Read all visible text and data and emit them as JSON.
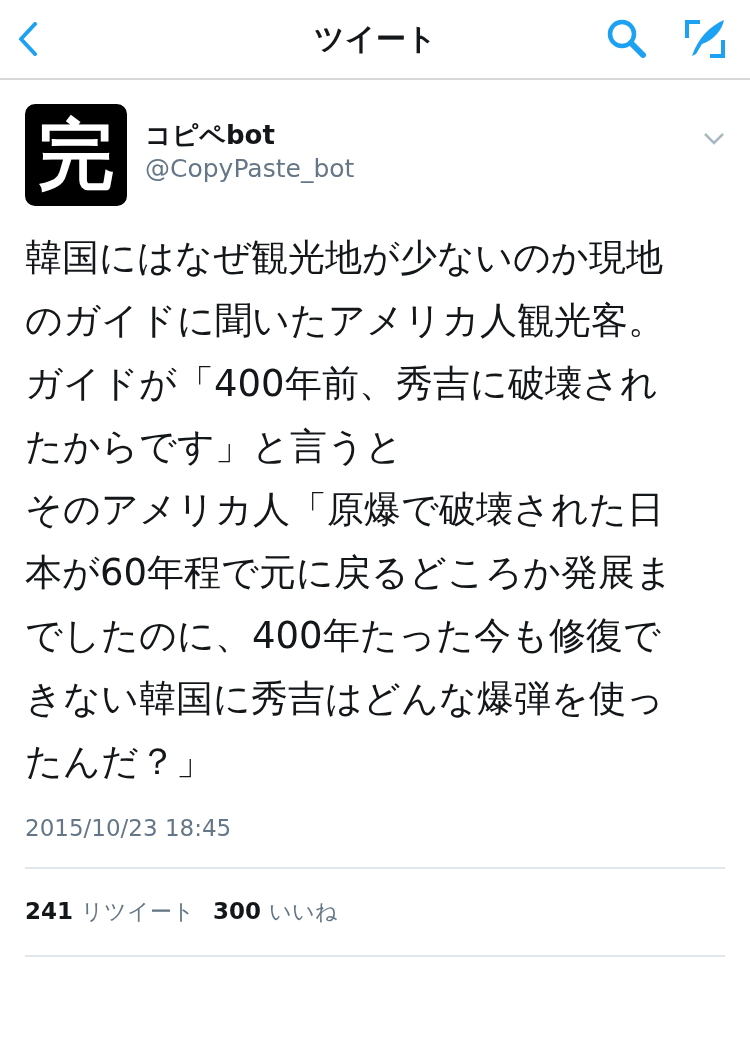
{
  "header": {
    "title": "ツイート"
  },
  "tweet": {
    "avatar_text": "完",
    "name": "コピペbot",
    "handle": "@CopyPaste_bot",
    "paragraphs": [
      "韓国にはなぜ観光地が少ないのか現地のガイドに聞いたアメリカ人観光客。",
      "ガイドが「400年前、秀吉に破壊されたからです」と言うと",
      "そのアメリカ人「原爆で破壊された日本が60年程で元に戻るどころか発展までしたのに、400年たった今も修復できない韓国に秀吉はどんな爆弾を使ったんだ？」"
    ],
    "timestamp": "2015/10/23 18:45",
    "stats": [
      {
        "count": "241",
        "label": "リツイート"
      },
      {
        "count": "300",
        "label": "いいね"
      }
    ]
  }
}
